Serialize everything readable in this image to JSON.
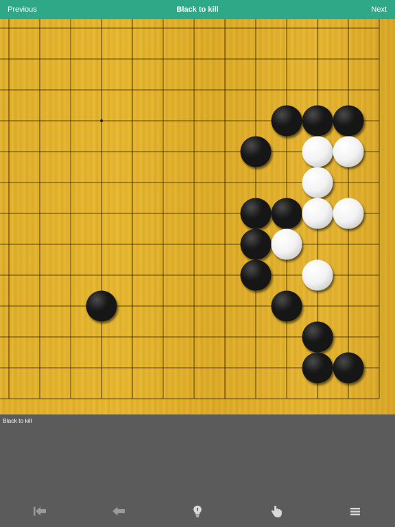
{
  "navbar": {
    "prev_label": "Previous",
    "title": "Black to kill",
    "next_label": "Next"
  },
  "board": {
    "visible_columns": 13,
    "visible_rows": 13,
    "black_stones": [
      [
        9,
        3
      ],
      [
        10,
        3
      ],
      [
        11,
        3
      ],
      [
        8,
        4
      ],
      [
        8,
        6
      ],
      [
        9,
        6
      ],
      [
        8,
        7
      ],
      [
        8,
        8
      ],
      [
        3,
        9
      ],
      [
        9,
        9
      ],
      [
        10,
        10
      ],
      [
        10,
        11
      ],
      [
        11,
        11
      ]
    ],
    "white_stones": [
      [
        10,
        4
      ],
      [
        11,
        4
      ],
      [
        10,
        5
      ],
      [
        10,
        6
      ],
      [
        11,
        6
      ],
      [
        9,
        7
      ],
      [
        10,
        8
      ]
    ],
    "star_points": [
      [
        3,
        3
      ]
    ],
    "colors": {
      "grid_line": "#2a1f05",
      "black_stone": "#111111",
      "white_stone": "#f2f2f2"
    }
  },
  "comment": {
    "text": "Black to kill"
  },
  "toolbar": {
    "icons": [
      "skip-to-start-icon",
      "back-arrow-icon",
      "hint-lightbulb-icon",
      "tap-hand-icon",
      "menu-icon"
    ],
    "icon_color": "#d8d8d8",
    "dim_icon_color": "#9a9a9a"
  }
}
